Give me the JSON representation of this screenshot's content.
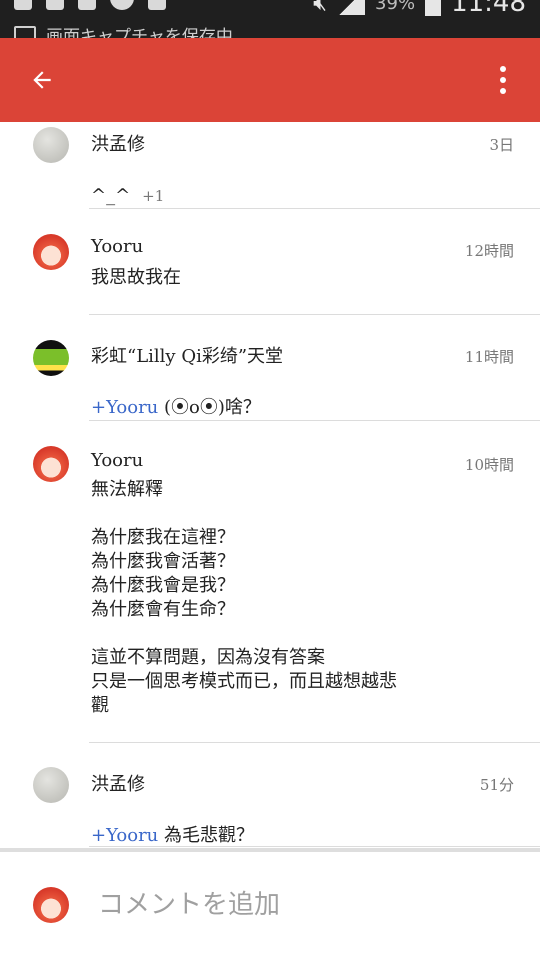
{
  "status_bar": {
    "notification_text": "画面キャプチャを保存中",
    "battery": "39%",
    "time": "11:48"
  },
  "app_bar": {
    "background": "#db4437",
    "back_icon": "arrow-back-icon",
    "menu_icon": "more-vert-icon"
  },
  "comments": [
    {
      "author": "洪孟修",
      "time": "3日",
      "text": "^_^",
      "plus_one": "+1"
    },
    {
      "author": "Yooru",
      "time": "12時間",
      "text": "我思故我在"
    },
    {
      "author": "彩虹“Lilly Qi彩绮”天堂",
      "time": "11時間",
      "mention": "+Yooru",
      "text": " (⦿o⦿)啥？"
    },
    {
      "author": "Yooru",
      "time": "10時間",
      "text": "無法解釋\n\n為什麼我在這裡？\n為什麼我會活著？\n為什麼我會是我？\n為什麼會有生命？\n\n這並不算問題，因為沒有答案\n只是一個思考模式而已，而且越想越悲\n觀"
    },
    {
      "author": "洪孟修",
      "time": "51分",
      "mention": "+Yooru",
      "text": " 為毛悲觀？"
    }
  ],
  "composer": {
    "placeholder": "コメントを追加"
  },
  "colors": {
    "mention": "#3a67c9",
    "divider": "#dcdcdc"
  }
}
